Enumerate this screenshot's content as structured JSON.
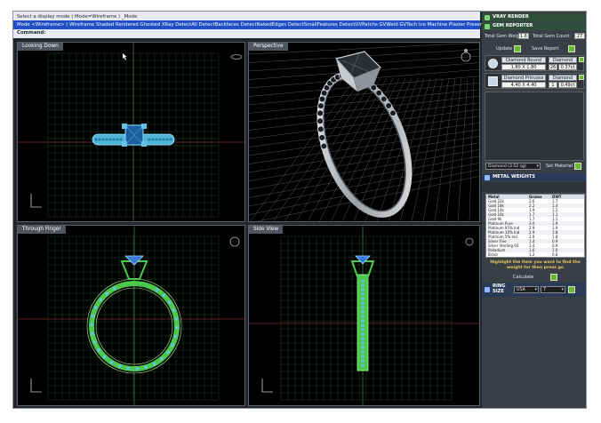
{
  "command": {
    "line1": "Select a display mode ( Mode=Wireframe ) _Mode",
    "line2": "Mode <Wireframe>  ( Wireframe  Shaded  Rendered  Ghosted  XRay  DetectAll  DetectBackfaces  DetectNakedEdges  DetectSmallFeatures  DetectUVPatchs  GVWeld  GVTech  Ico  Machine  Plaster  Presentation",
    "line3": "Command:"
  },
  "viewports": {
    "top": {
      "title": "Looking Down"
    },
    "perspective": {
      "title": "Perspective"
    },
    "front": {
      "title": "Through Finger"
    },
    "side": {
      "title": "Side View"
    }
  },
  "panel": {
    "vray_header": "VRAY RENDER",
    "gem_header": "GEM REPORTER",
    "total_gem_weight_label": "Total Gem Weight",
    "total_gem_weight": "1.6",
    "total_gem_count_label": "Total Gem Count",
    "total_gem_count": "27",
    "update_label": "Update",
    "save_report_label": "Save Report",
    "gems": [
      {
        "name": "Diamond Round",
        "size": "1.80 X 1.80",
        "count": "26",
        "carat": "0.37ct",
        "shape": "round"
      },
      {
        "name": "Diamond Princess",
        "size": "4.40 X 4.40",
        "count": "1",
        "carat": "0.49ct",
        "shape": "square"
      }
    ],
    "material_select": "Diamond (3.52 sg)",
    "set_material_label": "Set Material",
    "metal_header": "METAL WEIGHTS",
    "metal_headers": [
      "Metal",
      "Grams",
      "DWT"
    ],
    "metals": [
      [
        "Gold 22k",
        "2.6",
        "1.7"
      ],
      [
        "Gold 18k",
        "2.2",
        "1.4"
      ],
      [
        "Gold 14k",
        "1.9",
        "1.2"
      ],
      [
        "Gold 10k",
        "1.7",
        "1.1"
      ],
      [
        "Gold 9k",
        "1.7",
        "1.1"
      ],
      [
        "Platinum Pure",
        "3.0",
        "1.9"
      ],
      [
        "Platinum 95% Ind",
        "2.9",
        "1.9"
      ],
      [
        "Platinum 10% Ind",
        "2.9",
        "1.8"
      ],
      [
        "Platinum 5% Ind",
        "2.9",
        "1.8"
      ],
      [
        "Silver Fine",
        "1.4",
        "0.9"
      ],
      [
        "Silver Sterling 92",
        "1.4",
        "0.9"
      ],
      [
        "Palladium",
        "1.6",
        "1.0"
      ],
      [
        "Brass",
        "1.2",
        "0.8"
      ]
    ],
    "highlight_note": "Highlight the item you want to find the weight for then press go",
    "calculate_label": "Calculate",
    "ring_header": "RING SIZE",
    "ring_region": "USA",
    "ring_size": "7"
  },
  "colors": {
    "wire_green": "#4cc94c",
    "wire_cyan": "#63c3e8",
    "grid": "#2a4a2a",
    "panel_header": "#2f4f3a",
    "button_green": "#6fb23a"
  }
}
